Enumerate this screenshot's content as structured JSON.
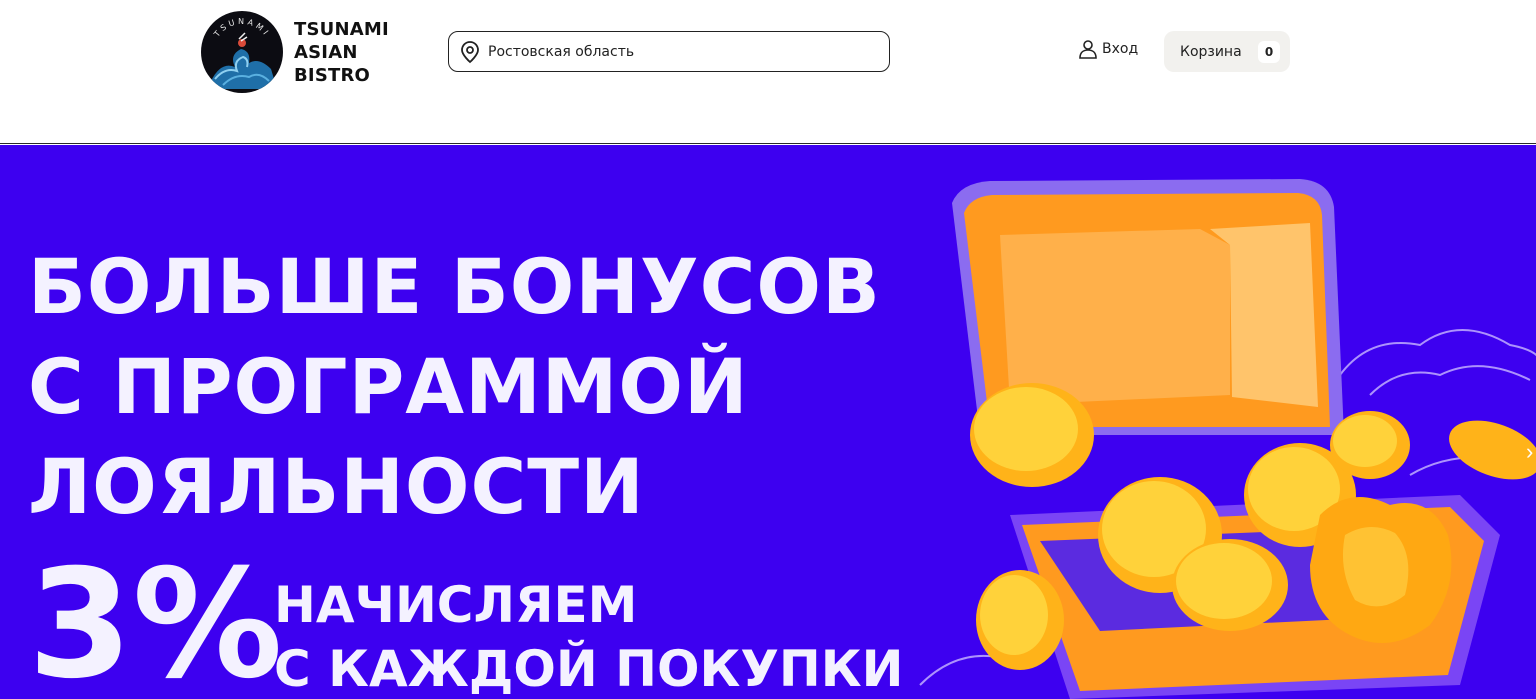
{
  "header": {
    "logo": {
      "line1": "TSUNAMI",
      "line2": "ASIAN",
      "line3": "BISTRO",
      "emblem_text": "TSUNAMI"
    },
    "location": {
      "value": "Ростовская область",
      "icon": "map-pin-icon"
    },
    "login": {
      "label": "Вход",
      "icon": "user-icon"
    },
    "cart": {
      "label": "Корзина",
      "count": "0"
    }
  },
  "banner": {
    "headline": [
      "БОЛЬШЕ БОНУСОВ",
      "С ПРОГРАММОЙ",
      "ЛОЯЛЬНОСТИ"
    ],
    "percent": "3%",
    "subline": [
      "НАЧИСЛЯЕМ",
      "С КАЖДОЙ ПОКУПКИ"
    ],
    "background_color": "#3d00f0",
    "illustration": "treasure-chest-with-coins"
  }
}
